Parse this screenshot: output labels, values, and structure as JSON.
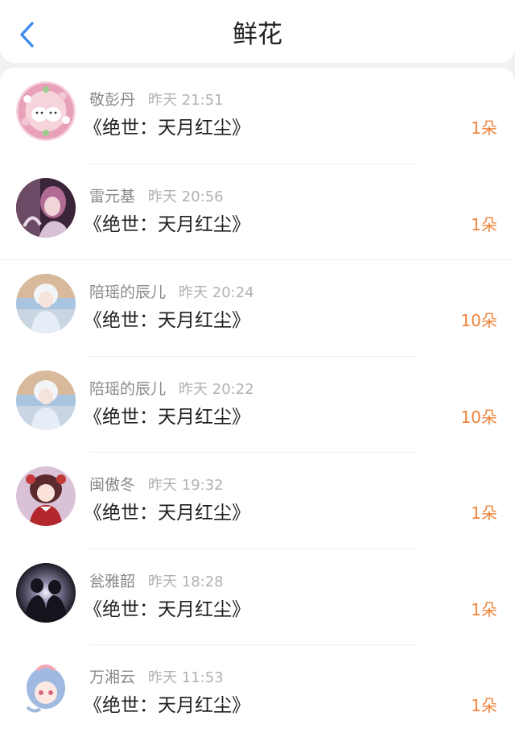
{
  "header": {
    "title": "鲜花",
    "back_icon": "chevron-left-icon",
    "accent": "#3d8ef0"
  },
  "colors": {
    "count": "#f0833a",
    "name": "#8a8a8a",
    "time": "#b1b1b1"
  },
  "items": [
    {
      "name": "敬彭丹",
      "time": "昨天 21:51",
      "book": "《绝世：天月红尘》",
      "count": "1朵",
      "avatar": "cat-flower-wreath"
    },
    {
      "name": "雷元基",
      "time": "昨天 20:56",
      "book": "《绝世：天月红尘》",
      "count": "1朵",
      "avatar": "anime-purple-girl"
    },
    {
      "name": "陪瑶的辰儿",
      "time": "昨天 20:24",
      "book": "《绝世：天月红尘》",
      "count": "10朵",
      "avatar": "anime-white-hair-boy"
    },
    {
      "name": "陪瑶的辰儿",
      "time": "昨天 20:22",
      "book": "《绝世：天月红尘》",
      "count": "10朵",
      "avatar": "anime-white-hair-boy"
    },
    {
      "name": "闽傲冬",
      "time": "昨天 19:32",
      "book": "《绝世：天月红尘》",
      "count": "1朵",
      "avatar": "anime-red-dress-girl"
    },
    {
      "name": "瓮雅韶",
      "time": "昨天 18:28",
      "book": "《绝世：天月红尘》",
      "count": "1朵",
      "avatar": "couple-silhouette"
    },
    {
      "name": "万湘云",
      "time": "昨天 11:53",
      "book": "《绝世：天月红尘》",
      "count": "1朵",
      "avatar": "anime-blue-hair-girl"
    }
  ]
}
